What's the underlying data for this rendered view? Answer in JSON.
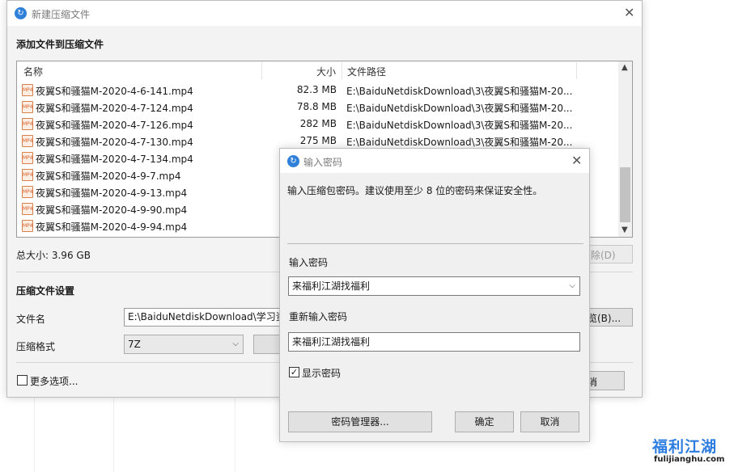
{
  "main": {
    "title": "新建压缩文件",
    "section_add": "添加文件到压缩文件",
    "columns": {
      "name": "名称",
      "size": "大小",
      "path": "文件路径"
    },
    "files": [
      {
        "name": "夜翼S和骚猫M-2020-4-6-141.mp4",
        "size": "82.3 MB",
        "path": "E:\\BaiduNetdiskDownload\\3\\夜翼S和骚猫M-20..."
      },
      {
        "name": "夜翼S和骚猫M-2020-4-7-124.mp4",
        "size": "78.8 MB",
        "path": "E:\\BaiduNetdiskDownload\\3\\夜翼S和骚猫M-20..."
      },
      {
        "name": "夜翼S和骚猫M-2020-4-7-126.mp4",
        "size": "282 MB",
        "path": "E:\\BaiduNetdiskDownload\\3\\夜翼S和骚猫M-20..."
      },
      {
        "name": "夜翼S和骚猫M-2020-4-7-130.mp4",
        "size": "275 MB",
        "path": "E:\\BaiduNetdiskDownload\\3\\夜翼S和骚猫M-20..."
      },
      {
        "name": "夜翼S和骚猫M-2020-4-7-134.mp4",
        "size": "",
        "path": ""
      },
      {
        "name": "夜翼S和骚猫M-2020-4-9-7.mp4",
        "size": "",
        "path": ""
      },
      {
        "name": "夜翼S和骚猫M-2020-4-9-13.mp4",
        "size": "",
        "path": ""
      },
      {
        "name": "夜翼S和骚猫M-2020-4-9-90.mp4",
        "size": "",
        "path": ""
      },
      {
        "name": "夜翼S和骚猫M-2020-4-9-94.mp4",
        "size": "",
        "path": ""
      }
    ],
    "total_size": "总大小: 3.96 GB",
    "remove_label": "除(D)",
    "settings_title": "压缩文件设置",
    "filename_label": "文件名",
    "filename_value": "E:\\BaiduNetdiskDownload\\学习资",
    "browse_label": "览(B)...",
    "format_label": "压缩格式",
    "format_value": "7Z",
    "more_options": "更多选项...",
    "cancel_partial": "消"
  },
  "dialog": {
    "title": "输入密码",
    "info": "输入压缩包密码。建议使用至少 8 位的密码来保证安全性。",
    "password_label": "输入密码",
    "password_value": "来福利江湖找福利",
    "reenter_label": "重新输入密码",
    "reenter_value": "来福利江湖找福利",
    "show_password_label": "显示密码",
    "show_password_checked": true,
    "manager_button": "密码管理器...",
    "ok_button": "确定",
    "cancel_button": "取消"
  },
  "watermark": {
    "brand": "福利江湖",
    "url": "fulijianghu.com"
  },
  "colors": {
    "accent": "#2f80d9",
    "file_icon": "#d9622b"
  }
}
